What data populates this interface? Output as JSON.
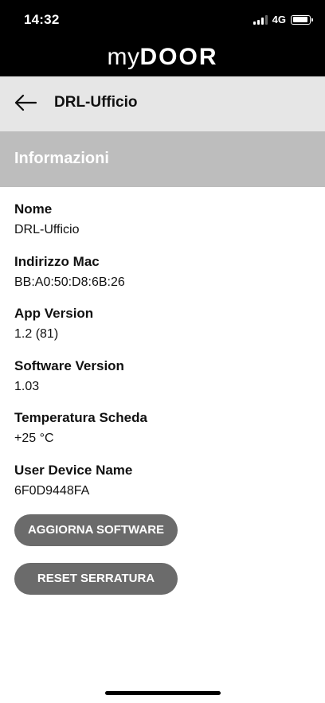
{
  "status_bar": {
    "time": "14:32",
    "network": "4G",
    "battery_level": 0.9
  },
  "brand": {
    "logo_prefix": "my",
    "logo_suffix": "DOOR"
  },
  "nav": {
    "back_icon": "arrow-left-icon",
    "title": "DRL-Ufficio"
  },
  "section": {
    "title": "Informazioni"
  },
  "info": {
    "items": [
      {
        "label": "Nome",
        "value": "DRL-Ufficio"
      },
      {
        "label": "Indirizzo Mac",
        "value": "BB:A0:50:D8:6B:26"
      },
      {
        "label": "App Version",
        "value": "1.2 (81)"
      },
      {
        "label": "Software Version",
        "value": "1.03"
      },
      {
        "label": "Temperatura Scheda",
        "value": "+25 °C"
      },
      {
        "label": "User Device Name",
        "value": "6F0D9448FA"
      }
    ]
  },
  "actions": {
    "update_label": "AGGIORNA SOFTWARE",
    "reset_label": "RESET SERRATURA"
  },
  "colors": {
    "header_bg": "#000000",
    "nav_bg": "#e6e6e6",
    "section_bg": "#bdbdbd",
    "button_bg": "#6b6b6b"
  }
}
